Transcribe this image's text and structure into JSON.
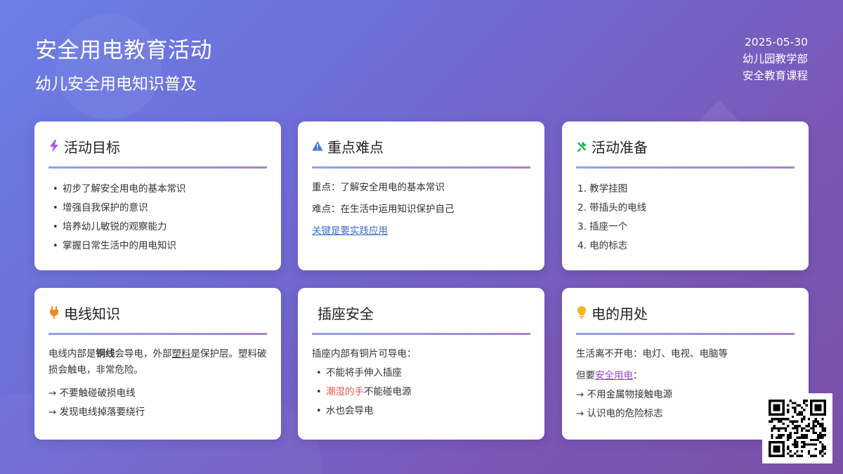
{
  "header": {
    "title": "安全用电教育活动",
    "subtitle": "幼儿安全用电知识普及"
  },
  "meta": {
    "date": "2025-05-30",
    "department": "幼儿园教学部",
    "course": "安全教育课程"
  },
  "cards": {
    "goals": {
      "icon": "lightning-icon",
      "title": "活动目标",
      "items": [
        "初步了解安全用电的基本常识",
        "增强自我保护的意识",
        "培养幼儿敏锐的观察能力",
        "掌握日常生活中的用电知识"
      ]
    },
    "keypoints": {
      "icon": "warning-icon",
      "title": "重点难点",
      "key": "重点：了解安全用电的基本常识",
      "difficulty": "难点：在生活中运用知识保护自己",
      "link": "关键是要实践应用"
    },
    "prep": {
      "icon": "tools-icon",
      "title": "活动准备",
      "items": [
        "1. 教学挂图",
        "2. 带插头的电线",
        "3. 插座一个",
        "4. 电的标志"
      ]
    },
    "wire": {
      "icon": "plug-icon",
      "title": "电线知识",
      "text_a": "电线内部是",
      "text_b": "铜线",
      "text_c": "会导电，外部",
      "text_d": "塑料",
      "text_e": "是保护层。塑料破损会触电，非常危险。",
      "tip1": "→ 不要触碰破损电线",
      "tip2": "→ 发现电线掉落要绕行"
    },
    "socket": {
      "title": "插座安全",
      "intro": "插座内部有铜片可导电：",
      "item1": "不能将手伸入插座",
      "item2_red": "潮湿的手",
      "item2_rest": "不能碰电源",
      "item3": "水也会导电"
    },
    "usage": {
      "icon": "lightbulb-icon",
      "title": "电的用处",
      "line1": "生活离不开电：电灯、电视、电脑等",
      "line2_a": "但要",
      "line2_link": "安全用电",
      "line2_b": "：",
      "tip1": "→ 不用金属物接触电源",
      "tip2": "→ 认识电的危险标志"
    }
  },
  "colors": {
    "accent_purple": "#9b46c8",
    "accent_blue": "#3a6fd0",
    "danger_red": "#e05a52",
    "icon_green": "#2ab36a",
    "icon_orange": "#f08a1c",
    "icon_yellow": "#f2b81c"
  }
}
